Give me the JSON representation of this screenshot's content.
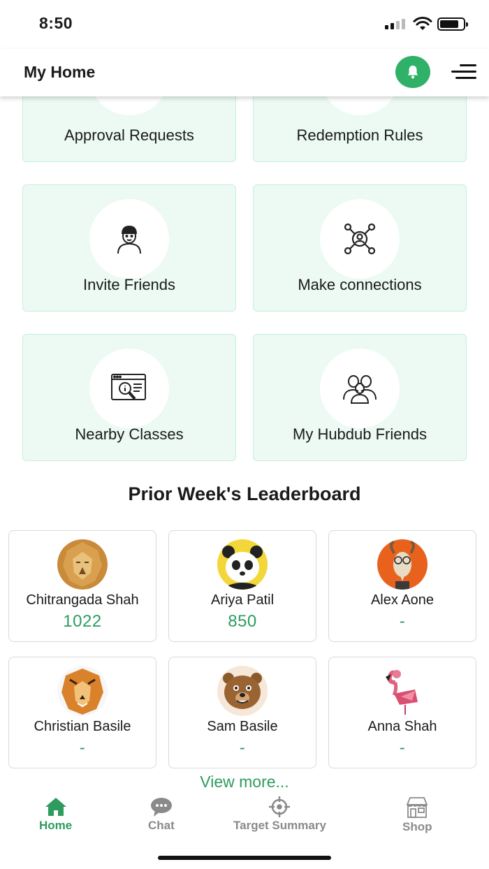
{
  "status_bar": {
    "time": "8:50"
  },
  "header": {
    "title": "My Home"
  },
  "tiles": [
    {
      "label": "Approval Requests",
      "icon": "approval-icon"
    },
    {
      "label": "Redemption Rules",
      "icon": "rules-icon"
    },
    {
      "label": "Invite Friends",
      "icon": "person-icon"
    },
    {
      "label": "Make connections",
      "icon": "connections-icon"
    },
    {
      "label": "Nearby Classes",
      "icon": "search-browser-icon"
    },
    {
      "label": "My Hubdub Friends",
      "icon": "friends-icon"
    }
  ],
  "leaderboard": {
    "title": "Prior Week's Leaderboard",
    "entries": [
      {
        "name": "Chitrangada Shah",
        "score": "1022",
        "avatar": "lion-avatar"
      },
      {
        "name": "Ariya Patil",
        "score": "850",
        "avatar": "panda-avatar"
      },
      {
        "name": "Alex Aone",
        "score": "-",
        "avatar": "goat-avatar"
      },
      {
        "name": "Christian Basile",
        "score": "-",
        "avatar": "tiger-avatar"
      },
      {
        "name": "Sam Basile",
        "score": "-",
        "avatar": "bear-avatar"
      },
      {
        "name": "Anna Shah",
        "score": "-",
        "avatar": "flamingo-avatar"
      }
    ],
    "view_more": "View more..."
  },
  "bottom_nav": [
    {
      "label": "Home",
      "icon": "home-icon",
      "active": true
    },
    {
      "label": "Chat",
      "icon": "chat-icon",
      "active": false
    },
    {
      "label": "Target Summary",
      "icon": "target-icon",
      "active": false
    },
    {
      "label": "Shop",
      "icon": "shop-icon",
      "active": false
    }
  ],
  "colors": {
    "accent": "#2e9b5f",
    "tile_bg": "#ecfaf3",
    "bell_bg": "#2fb167"
  }
}
